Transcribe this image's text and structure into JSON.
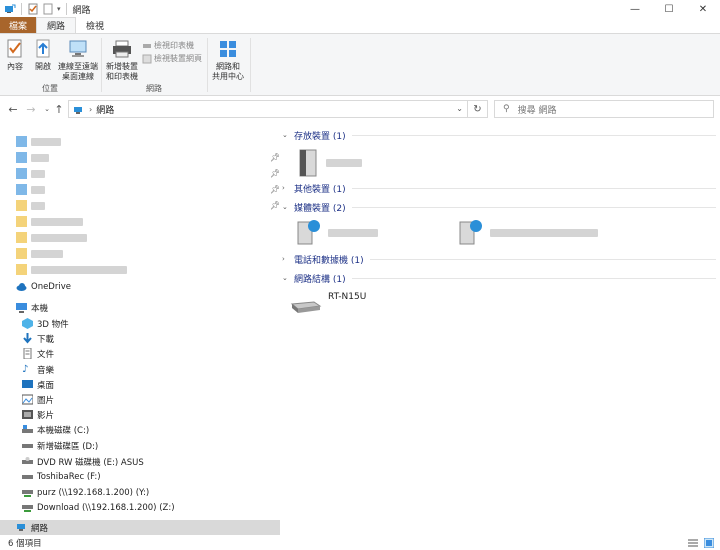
{
  "window": {
    "title": "網路",
    "minimize": "—",
    "maximize": "☐",
    "close": "✕"
  },
  "tabs": [
    {
      "label": "檔案"
    },
    {
      "label": "網路"
    },
    {
      "label": "檢視"
    }
  ],
  "ribbon": {
    "location_group": "位置",
    "network_group": "網路",
    "properties": "內容",
    "open": "開啟",
    "connect_remote": "連線至遠端",
    "connect_remote2": "桌面連線",
    "add_devices": "新增裝置",
    "add_devices2": "和印表機",
    "view_printers": "檢視印表機",
    "view_device_web": "檢視裝置網頁",
    "network_center": "網路和",
    "network_center2": "共用中心"
  },
  "address": {
    "crumb": "網路",
    "search_placeholder": "搜尋 網路"
  },
  "nav": {
    "onedrive": "OneDrive",
    "thispc": "本機",
    "objects3d": "3D 物件",
    "downloads": "下載",
    "documents": "文件",
    "music": "音樂",
    "desktop": "桌面",
    "pictures": "圖片",
    "videos": "影片",
    "drive_c": "本機磁碟 (C:)",
    "drive_d": "新增磁碟區 (D:)",
    "drive_e": "DVD RW 磁碟機 (E:) ASUS",
    "drive_f": "ToshibaRec (F:)",
    "drive_y": "purz (\\\\192.168.1.200) (Y:)",
    "drive_z": "Download (\\\\192.168.1.200) (Z:)",
    "network": "網路"
  },
  "content": {
    "storage": "存放裝置 (1)",
    "other": "其他裝置 (1)",
    "media": "媒體裝置 (2)",
    "phone": "電話和數據機 (1)",
    "infra": "網路結構 (1)",
    "router": "RT-N15U"
  },
  "status": {
    "count": "6 個項目"
  },
  "colors": {
    "file_tab": "#a8652b",
    "accent": "#1e73be",
    "group_header": "#1e3287"
  }
}
